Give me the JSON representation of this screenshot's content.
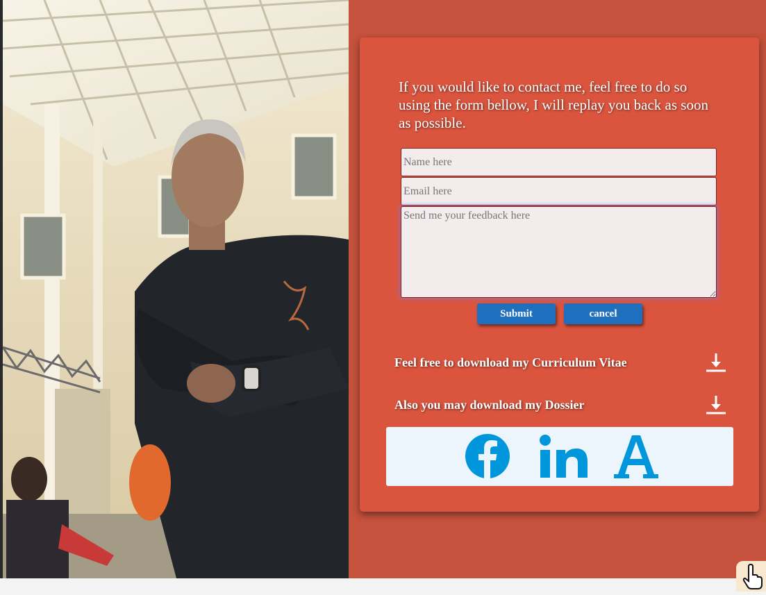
{
  "contact": {
    "intro": "If you would like to contact me, feel free to do so using the form bellow, I will replay you back as soon as possible.",
    "name_placeholder": "Name here",
    "email_placeholder": "Email here",
    "feedback_placeholder": "Send me your feedback here",
    "submit_label": "Submit",
    "cancel_label": "cancel"
  },
  "downloads": {
    "cv_label": "Feel free to download my Curriculum Vitae",
    "dossier_label": "Also you may download my Dossier",
    "icon": "download-icon"
  },
  "social": {
    "icons": [
      "facebook-icon",
      "linkedin-icon",
      "academia-icon"
    ],
    "brand_color": "#0096dc"
  },
  "colors": {
    "page_bg": "#c4523c",
    "card_bg": "#db553e",
    "button_bg": "#1f6fbf",
    "social_bg": "#edf5fc"
  }
}
